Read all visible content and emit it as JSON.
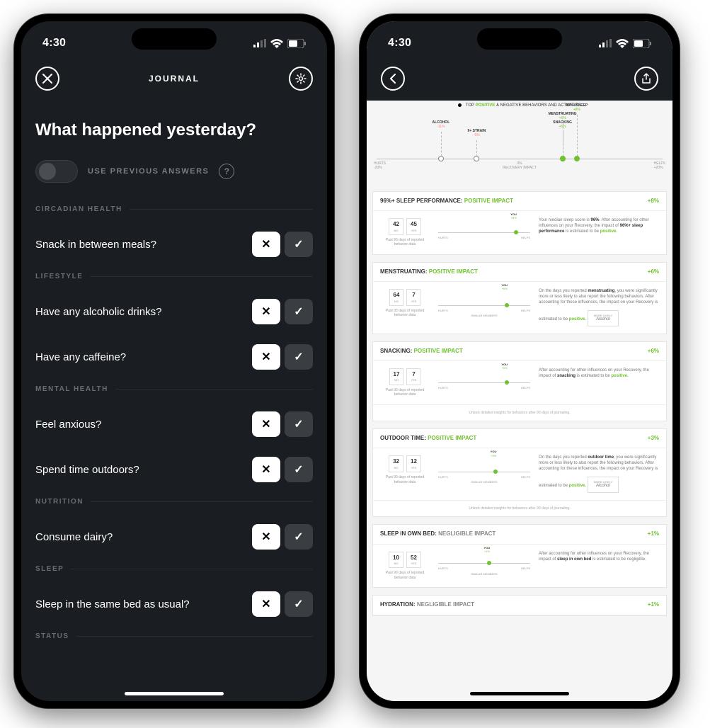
{
  "status": {
    "time": "4:30"
  },
  "left": {
    "header_title": "JOURNAL",
    "question": "What happened yesterday?",
    "toggle_label": "USE PREVIOUS ANSWERS",
    "sections": [
      {
        "label": "CIRCADIAN HEALTH",
        "items": [
          {
            "q": "Snack in between meals?"
          }
        ]
      },
      {
        "label": "LIFESTYLE",
        "items": [
          {
            "q": "Have any alcoholic drinks?"
          },
          {
            "q": "Have any caffeine?"
          }
        ]
      },
      {
        "label": "MENTAL HEALTH",
        "items": [
          {
            "q": "Feel anxious?"
          },
          {
            "q": "Spend time outdoors?"
          }
        ]
      },
      {
        "label": "NUTRITION",
        "items": [
          {
            "q": "Consume dairy?"
          }
        ]
      },
      {
        "label": "SLEEP",
        "items": [
          {
            "q": "Sleep in the same bed as usual?"
          }
        ]
      },
      {
        "label": "STATUS",
        "items": []
      }
    ]
  },
  "right": {
    "chart_caption_pre": "TOP ",
    "chart_caption_pos": "POSITIVE",
    "chart_caption_mid": " & NEGATIVE BEHAVIORS AND ",
    "chart_caption_act": "ACTIVITIES",
    "axis": {
      "left": "HURTS",
      "right": "HELPS",
      "center_top": "0%",
      "center_bottom": "RECOVERY IMPACT",
      "min": "-20%",
      "max": "+20%"
    },
    "chart_data": {
      "type": "scatter",
      "xlabel": "RECOVERY IMPACT",
      "xlim": [
        -20,
        20
      ],
      "points": [
        {
          "label": "ALCOHOL",
          "value": -11
        },
        {
          "label": "9+ STRAIN",
          "value": -6
        },
        {
          "label": "SNACKING",
          "value": 6
        },
        {
          "label": "MENSTRUATING",
          "value": 6
        },
        {
          "label": "96%+ SLEEP",
          "value": 8
        }
      ]
    },
    "cards": [
      {
        "title": "96%+ SLEEP PERFORMANCE:",
        "impact": "POSITIVE IMPACT",
        "pct": "+8%",
        "n1": "42",
        "n1s": "NO",
        "n2": "45",
        "n2s": "YES",
        "caption": "Past 90 days of reported behavior data",
        "you": "YOU",
        "you_pct": "+8%",
        "dot_pos": 82,
        "text_pre": "Your median sleep score is ",
        "text_b": "96%",
        "text_mid": ". After accounting for other influences on your Recovery, the impact of ",
        "text_b2": "96%+ sleep performance",
        "text_post": " is estimated to be ",
        "text_green": "positive."
      },
      {
        "title": "MENSTRUATING:",
        "impact": "POSITIVE IMPACT",
        "pct": "+6%",
        "n1": "64",
        "n1s": "NO",
        "n2": "7",
        "n2s": "YES",
        "caption": "Past 90 days of reported behavior data",
        "you": "YOU",
        "you_pct": "+6%",
        "dot_pos": 72,
        "similar": "SIMILAR MEMBERS",
        "text_pre": "On the days you reported ",
        "text_b": "menstruating",
        "text_mid": ", you were significantly more or less likely to also report the following behaviors. After accounting for these influences, the impact on your Recovery is estimated to be ",
        "text_green": "positive.",
        "badge_lbl": "MORE LIKELY",
        "badge_val": "Alcohol"
      },
      {
        "title": "SNACKING:",
        "impact": "POSITIVE IMPACT",
        "pct": "+6%",
        "n1": "17",
        "n1s": "NO",
        "n2": "7",
        "n2s": "YES",
        "caption": "Past 90 days of reported behavior data",
        "you": "YOU",
        "you_pct": "+6%",
        "dot_pos": 72,
        "text_pre": "After accounting for other influences on your Recovery, the impact of ",
        "text_b": "snacking",
        "text_mid": " is estimated to be ",
        "text_green": "positive.",
        "unlock": "Unlock detailed insights for behaviors after 90 days of journaling."
      },
      {
        "title": "OUTDOOR TIME:",
        "impact": "POSITIVE IMPACT",
        "pct": "+3%",
        "n1": "32",
        "n1s": "NO",
        "n2": "12",
        "n2s": "YES",
        "caption": "Past 90 days of reported behavior data",
        "you": "YOU",
        "you_pct": "+3%",
        "dot_pos": 60,
        "similar": "SIMILAR MEMBERS",
        "text_pre": "On the days you reported ",
        "text_b": "outdoor time",
        "text_mid": ", you were significantly more or less likely to also report the following behaviors. After accounting for these influences, the impact on your Recovery is estimated to be ",
        "text_green": "positive.",
        "badge_lbl": "MORE LIKELY",
        "badge_val": "Alcohol",
        "unlock": "Unlock detailed insights for behaviors after 90 days of journaling."
      },
      {
        "title": "SLEEP IN OWN BED:",
        "impact": "NEGLIGIBLE IMPACT",
        "impact_neg": true,
        "pct": "+1%",
        "n1": "10",
        "n1s": "NO",
        "n2": "52",
        "n2s": "YES",
        "caption": "Past 90 days of reported behavior data",
        "you": "YOU",
        "you_pct": "+1%",
        "dot_pos": 53,
        "similar": "SIMILAR MEMBERS",
        "text_pre": "After accounting for other influences on your Recovery, the impact of ",
        "text_b": "sleep in own bed",
        "text_mid": " is estimated to be negligible."
      },
      {
        "title": "HYDRATION:",
        "impact": "NEGLIGIBLE IMPACT",
        "impact_neg": true,
        "pct": "+1%"
      }
    ],
    "slider_hurts": "HURTS",
    "slider_helps": "HELPS"
  }
}
